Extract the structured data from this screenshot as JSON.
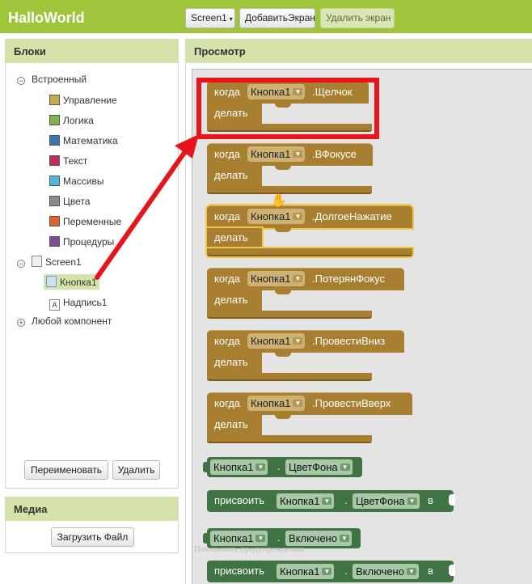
{
  "app": {
    "title": "HalloWorld"
  },
  "toolbar": {
    "screen_select": "Screen1",
    "add_screen": "ДобавитьЭкран",
    "remove_screen": "Удалить экран"
  },
  "blocks_panel": {
    "title": "Блоки",
    "builtin": {
      "label": "Встроенный",
      "items": [
        {
          "label": "Управление",
          "color": "#c7a94e"
        },
        {
          "label": "Логика",
          "color": "#7fb24b"
        },
        {
          "label": "Математика",
          "color": "#3f72b5"
        },
        {
          "label": "Текст",
          "color": "#c22c5b"
        },
        {
          "label": "Массивы",
          "color": "#4fb7dc"
        },
        {
          "label": "Цвета",
          "color": "#8a8a8a"
        },
        {
          "label": "Переменные",
          "color": "#e2632a"
        },
        {
          "label": "Процедуры",
          "color": "#7d4c97"
        }
      ]
    },
    "screen": {
      "label": "Screen1"
    },
    "components": [
      {
        "label": "Кнопка1"
      },
      {
        "label": "Надпись1"
      }
    ],
    "any_component": "Любой компонент",
    "rename_button": "Переименовать",
    "delete_button": "Удалить"
  },
  "media_panel": {
    "title": "Медиа",
    "upload_button": "Загрузить Файл"
  },
  "viewer": {
    "title": "Просмотр",
    "event_blocks": [
      {
        "when": "когда",
        "component": "Кнопка1",
        "event": ".Щелчок",
        "do": "делать"
      },
      {
        "when": "когда",
        "component": "Кнопка1",
        "event": ".ВФокусе",
        "do": "делать"
      },
      {
        "when": "когда",
        "component": "Кнопка1",
        "event": ".ДолгоеНажатие",
        "do": "делать"
      },
      {
        "when": "когда",
        "component": "Кнопка1",
        "event": ".ПотерянФокус",
        "do": "делать"
      },
      {
        "when": "когда",
        "component": "Кнопка1",
        "event": ".ПровестиВниз",
        "do": "делать"
      },
      {
        "when": "когда",
        "component": "Кнопка1",
        "event": ".ПровестиВверх",
        "do": "делать"
      }
    ],
    "property_blocks": [
      {
        "type": "getter",
        "component": "Кнопка1",
        "dot": ".",
        "property": "ЦветФона"
      },
      {
        "type": "setter",
        "set": "присвоить",
        "component": "Кнопка1",
        "dot": ".",
        "property": "ЦветФона",
        "to": "в"
      },
      {
        "type": "getter",
        "component": "Кнопка1",
        "dot": ".",
        "property": "Включено"
      },
      {
        "type": "setter",
        "set": "присвоить",
        "component": "Кнопка1",
        "dot": ".",
        "property": "Включено",
        "to": "в"
      }
    ],
    "warnings_text": "Показывать предупреждения"
  },
  "annotation": {
    "color": "#e8141c"
  }
}
